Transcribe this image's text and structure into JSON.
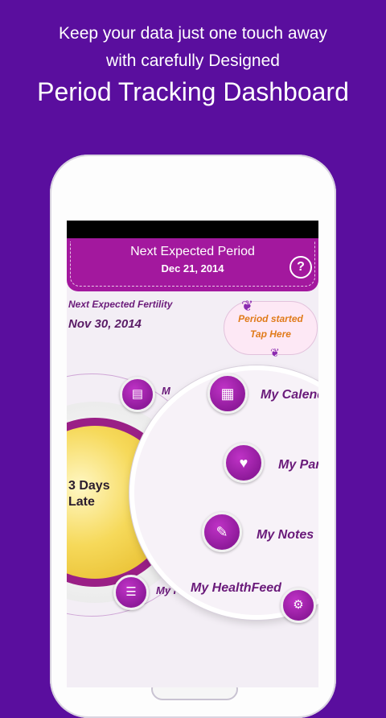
{
  "promo": {
    "line1": "Keep your data just one touch away",
    "line2": "with carefully Designed",
    "line3": "Period Tracking Dashboard"
  },
  "banner": {
    "title": "Next Expected Period",
    "date": "Dec 21, 2014",
    "help": "?"
  },
  "fertility": {
    "label": "Next Expected Fertility",
    "date": "Nov 30, 2014"
  },
  "cloud": {
    "line1": "Period started",
    "line2": "Tap Here"
  },
  "status": {
    "line1": "3 Days",
    "line2": "Late"
  },
  "menu": {
    "calendar": "My Calendar",
    "partner": "My Partner",
    "notes": "My Notes",
    "healthfeed": "My HealthFeed",
    "partial_healthfeed": "My H",
    "partial_left": "M"
  },
  "colors": {
    "background": "#5a0e9e",
    "accent": "#a3189e",
    "label": "#6a1a7a",
    "cloud_text": "#e07b1a"
  },
  "icons": {
    "calendar": "calendar-icon",
    "partner": "partner-icon",
    "notes": "notes-icon",
    "healthfeed": "healthfeed-icon",
    "docs": "document-icon",
    "settings": "gear-icon"
  }
}
